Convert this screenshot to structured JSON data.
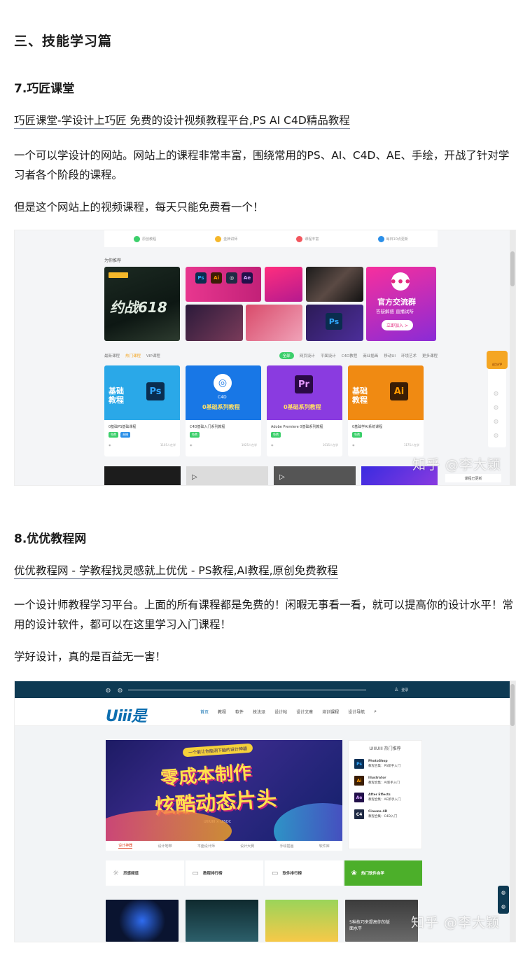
{
  "section": {
    "heading": "三、技能学习篇"
  },
  "item7": {
    "title": "7.巧匠课堂",
    "link": "巧匠课堂-学设计上巧匠 免费的设计视频教程平台,PS AI C4D精品教程",
    "para1": "一个可以学设计的网站。网站上的课程非常丰富，围绕常用的PS、AI、C4D、AE、手绘，开战了针对学习者各个阶段的课程。",
    "para2": "但是这个网站上的视频课程，每天只能免费看一个！",
    "screenshot": {
      "features": [
        "原创教程",
        "金牌讲师",
        "课程丰富",
        "每日10点更新"
      ],
      "recommend_label": "为你推荐",
      "banner_main_text": "约战618",
      "banner_group_title": "官方交流群",
      "banner_group_sub": "答疑解惑 直播试听",
      "banner_group_btn": "立即加入 >",
      "tabs": [
        "最新课程",
        "热门课程",
        "VIP课程"
      ],
      "filter_active": "全部",
      "filters": [
        "网页设计",
        "平面设计",
        "C4D教程",
        "商业插画",
        "移动UI",
        "环境艺术",
        "更多课程"
      ],
      "courses": [
        {
          "badge": "Ps",
          "big": "基础\n教程",
          "title": "0基础PS基础课程",
          "count": "1105人在学",
          "color": "#2aa8e8"
        },
        {
          "badge": "C4D",
          "big": "0基础系列教程",
          "title": "C4D基础入门系列教程",
          "count": "1025人在学",
          "color": "#1877e6"
        },
        {
          "badge": "Pr",
          "big": "0基础系列教程",
          "title": "Adobe Premiere 0基础系列教程",
          "count": "1015人在学",
          "color": "#8a3be0"
        },
        {
          "badge": "Ai",
          "big": "基础\n教程",
          "title": "0基础学AI系统课程",
          "count": "1175人在学",
          "color": "#f08a12"
        }
      ],
      "sidebar_vip": "成为VIP",
      "notify": "课程已更新",
      "watermark": "知乎 @李大颖"
    }
  },
  "item8": {
    "title": "8.优优教程网",
    "link": "优优教程网 - 学教程找灵感就上优优 - PS教程,AI教程,原创免费教程",
    "para1": "一个设计师教程学习平台。上面的所有课程都是免费的！闲暇无事看一看，就可以提高你的设计水平！常用的设计软件，都可以在这里学习入门课程！",
    "para2": "学好设计，真的是百益无一害！",
    "screenshot": {
      "logo": "Uiii是",
      "login": "登录",
      "menu": [
        "首页",
        "教程",
        "软件",
        "技法派",
        "设计帖",
        "设计文章",
        "培训课程",
        "设计导航"
      ],
      "hero_ribbon": "一个能让你脑洞下脑的设计神器",
      "hero_line1": "零成本制作",
      "hero_line2": "炫酷动态片头",
      "hero_sub": "UIIIUIII × UISDC",
      "hot_title": "UIIIUIII 热门推荐",
      "hot": [
        {
          "icon": "Ps",
          "name": "PhotoShop",
          "desc": "教程合集：PS新手入门",
          "color": "#0b3157"
        },
        {
          "icon": "Ai",
          "name": "Illustrator",
          "desc": "教程合集：AI新手入门",
          "color": "#3a1d05"
        },
        {
          "icon": "Ae",
          "name": "After Effects",
          "desc": "教程合集：AE新手入门",
          "color": "#22104a"
        },
        {
          "icon": "C4",
          "name": "Cinema 4D",
          "desc": "教程合集：C4D入门",
          "color": "#1f2a44"
        }
      ],
      "subtabs": [
        "设计神器",
        "设计地带",
        "平面设计师",
        "设计大赛",
        "手绘插画",
        "软件库"
      ],
      "features": [
        "灵感频道",
        "教程排行榜",
        "软件排行榜",
        "热门软件自学"
      ],
      "thumb_text": "5种技巧来提高你的版面水平",
      "watermark": "知乎 @李大颖"
    }
  }
}
